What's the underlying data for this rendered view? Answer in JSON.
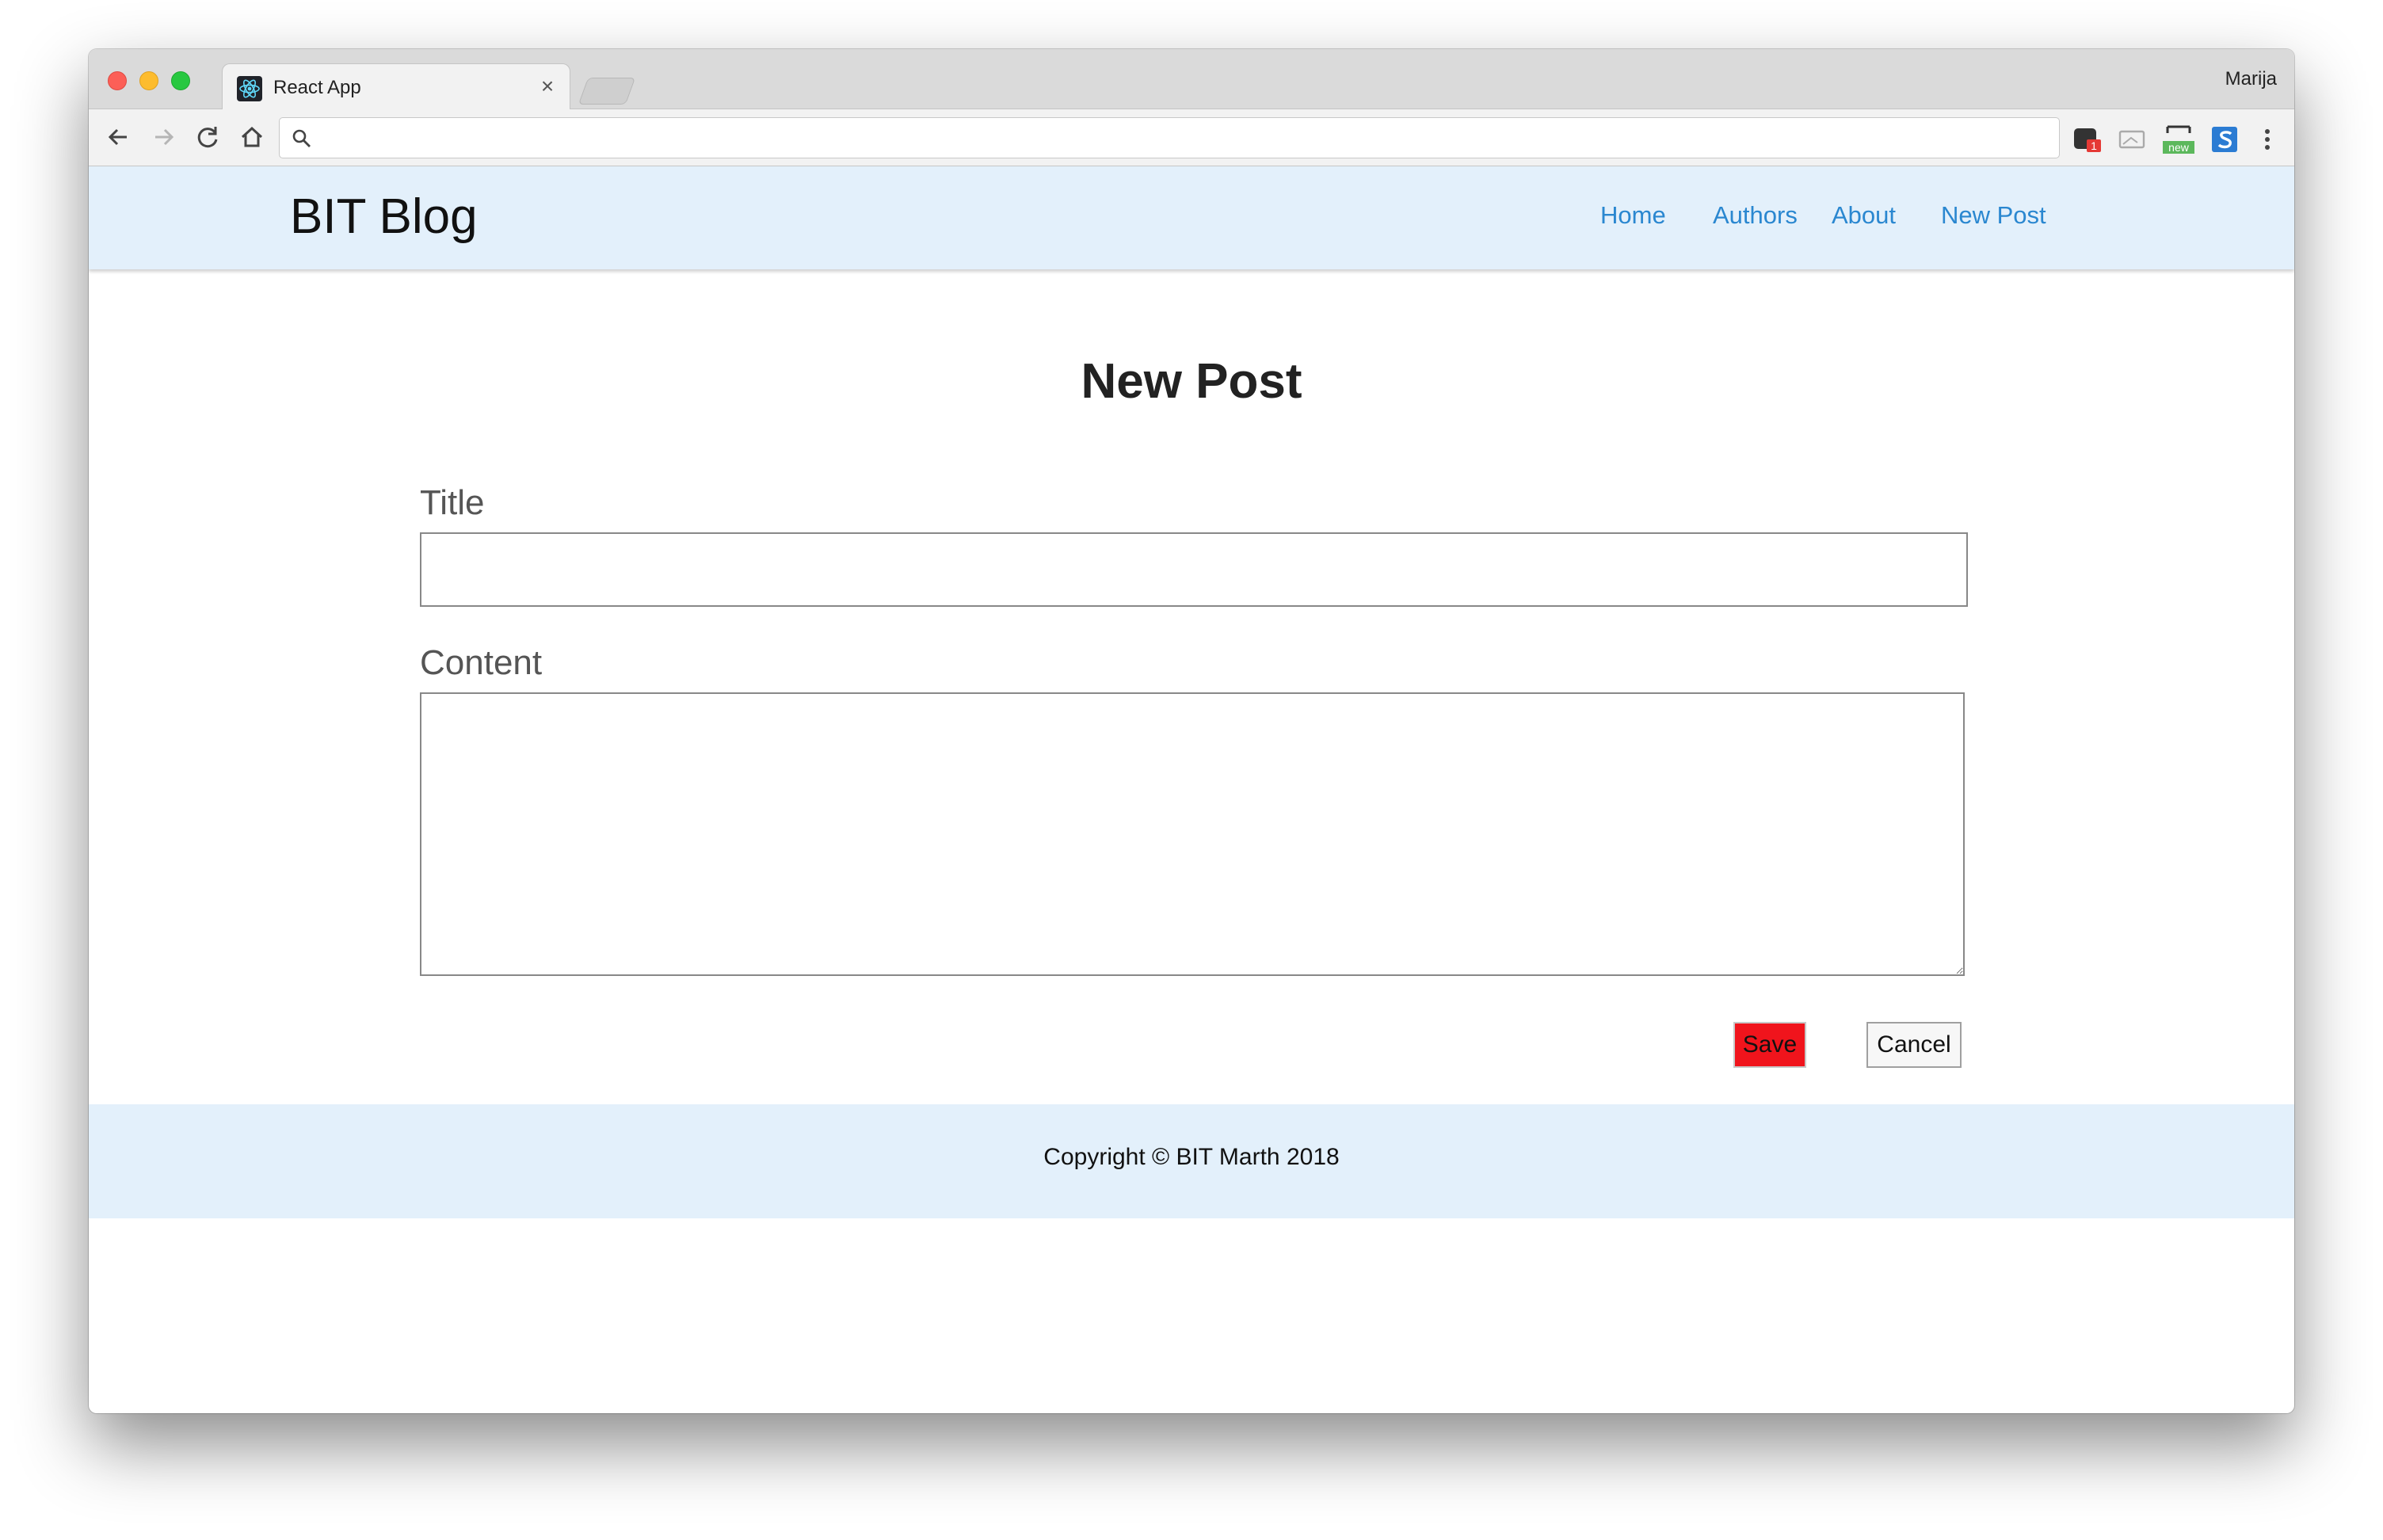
{
  "browser": {
    "tab_title": "React App",
    "tab_close": "×",
    "profile_name": "Marija",
    "address_value": "",
    "extension_badge": "1",
    "extension_new": "new"
  },
  "site": {
    "brand": "BIT Blog",
    "nav": [
      "Home",
      "Authors",
      "About",
      "New Post"
    ],
    "link_color": "#2a87d0",
    "header_bg": "#e3f0fb"
  },
  "form": {
    "heading": "New Post",
    "title_label": "Title",
    "title_value": "",
    "content_label": "Content",
    "content_value": "",
    "save_label": "Save",
    "cancel_label": "Cancel",
    "save_color": "#f0141c"
  },
  "footer": {
    "copyright": "Copyright © BIT Marth 2018"
  }
}
